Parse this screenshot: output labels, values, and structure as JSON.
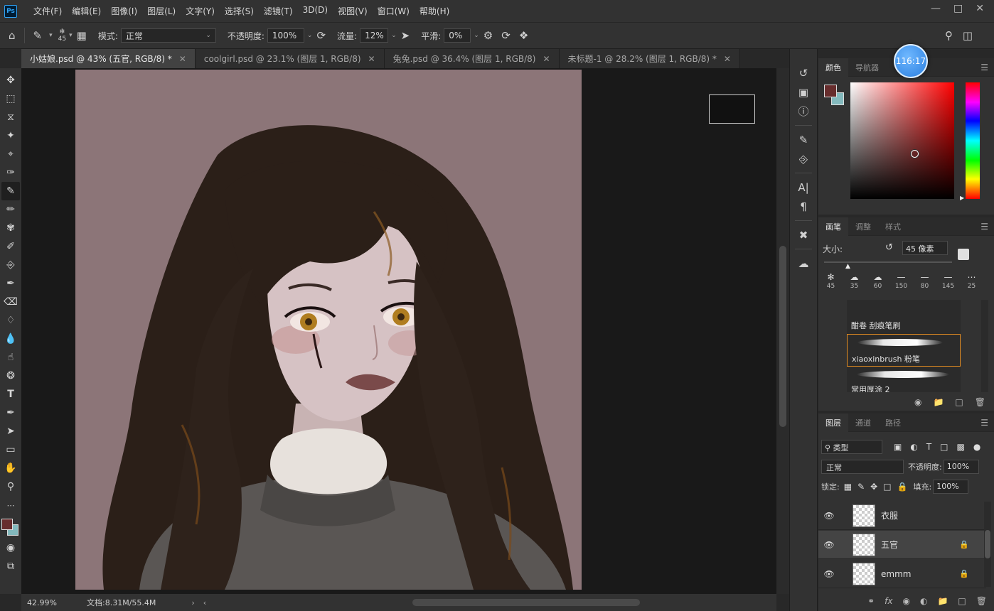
{
  "app": {
    "logo": "Ps",
    "menus": [
      "文件(F)",
      "编辑(E)",
      "图像(I)",
      "图层(L)",
      "文字(Y)",
      "选择(S)",
      "滤镜(T)",
      "3D(D)",
      "视图(V)",
      "窗口(W)",
      "帮助(H)"
    ]
  },
  "options": {
    "brush_size": "45",
    "mode_label": "模式:",
    "mode_value": "正常",
    "opacity_label": "不透明度:",
    "opacity_value": "100%",
    "flow_label": "流量:",
    "flow_value": "12%",
    "smooth_label": "平滑:",
    "smooth_value": "0%"
  },
  "tabs": [
    {
      "label": "小姑娘.psd @ 43% (五官, RGB/8) *",
      "active": true
    },
    {
      "label": "coolgirl.psd @ 23.1% (图层 1, RGB/8)",
      "active": false
    },
    {
      "label": "兔兔.psd @ 36.4% (图层 1, RGB/8)",
      "active": false
    },
    {
      "label": "未标题-1 @ 28.2% (图层 1, RGB/8) *",
      "active": false
    }
  ],
  "status": {
    "zoom": "42.99%",
    "doc": "文档:8.31M/55.4M"
  },
  "colors": {
    "foreground": "#672d2d",
    "background": "#83b9bd"
  },
  "overlay": {
    "time": "116:17"
  },
  "color_panel": {
    "tabs": [
      "颜色",
      "导航器"
    ]
  },
  "brush_panel": {
    "tabs": [
      "画笔",
      "调整",
      "样式"
    ],
    "size_label": "大小:",
    "size_value": "45 像素",
    "presets": [
      "45",
      "35",
      "60",
      "150",
      "80",
      "145",
      "25"
    ],
    "brushes": [
      "酣卷 刮痕笔刷",
      "xiaoxinbrush 粉笔",
      "常用厚涂 2"
    ]
  },
  "layers_panel": {
    "tabs": [
      "图层",
      "通道",
      "路径"
    ],
    "filter_label": "类型",
    "blend_mode": "正常",
    "opacity_label": "不透明度:",
    "opacity_value": "100%",
    "lock_label": "锁定:",
    "fill_label": "填充:",
    "fill_value": "100%",
    "layers": [
      {
        "name": "衣服",
        "locked": false,
        "selected": false
      },
      {
        "name": "五官",
        "locked": true,
        "selected": true
      },
      {
        "name": "emmm",
        "locked": true,
        "selected": false
      }
    ]
  }
}
